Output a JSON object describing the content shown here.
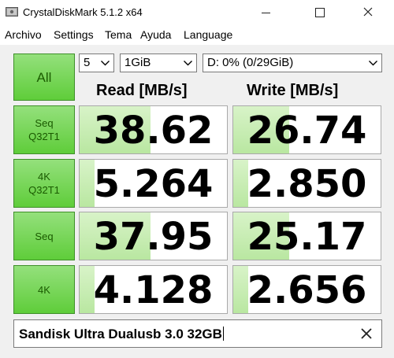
{
  "window": {
    "title": "CrystalDiskMark 5.1.2 x64",
    "icon": "crystaldiskmark-app-icon"
  },
  "menu": [
    "Archivo",
    "Settings",
    "Tema",
    "Ayuda",
    "Language"
  ],
  "controls": {
    "all_label": "All",
    "count": "5",
    "size": "1GiB",
    "drive": "D: 0% (0/29GiB)"
  },
  "headers": {
    "read": "Read [MB/s]",
    "write": "Write [MB/s]"
  },
  "tests": [
    {
      "label_top": "Seq",
      "label_bottom": "Q32T1",
      "read": "38.62",
      "write": "26.74",
      "read_bar": 0.48,
      "write_bar": 0.38
    },
    {
      "label_top": "4K",
      "label_bottom": "Q32T1",
      "read": "5.264",
      "write": "2.850",
      "read_bar": 0.1,
      "write_bar": 0.1
    },
    {
      "label_top": "Seq",
      "label_bottom": "",
      "read": "37.95",
      "write": "25.17",
      "read_bar": 0.48,
      "write_bar": 0.38
    },
    {
      "label_top": "4K",
      "label_bottom": "",
      "read": "4.128",
      "write": "2.656",
      "read_bar": 0.1,
      "write_bar": 0.1
    }
  ],
  "comment": {
    "text": "Sandisk Ultra Dualusb 3.0 32GB"
  },
  "colors": {
    "button_green": "#6fd34a",
    "bar_green": "#c8ecb4"
  }
}
